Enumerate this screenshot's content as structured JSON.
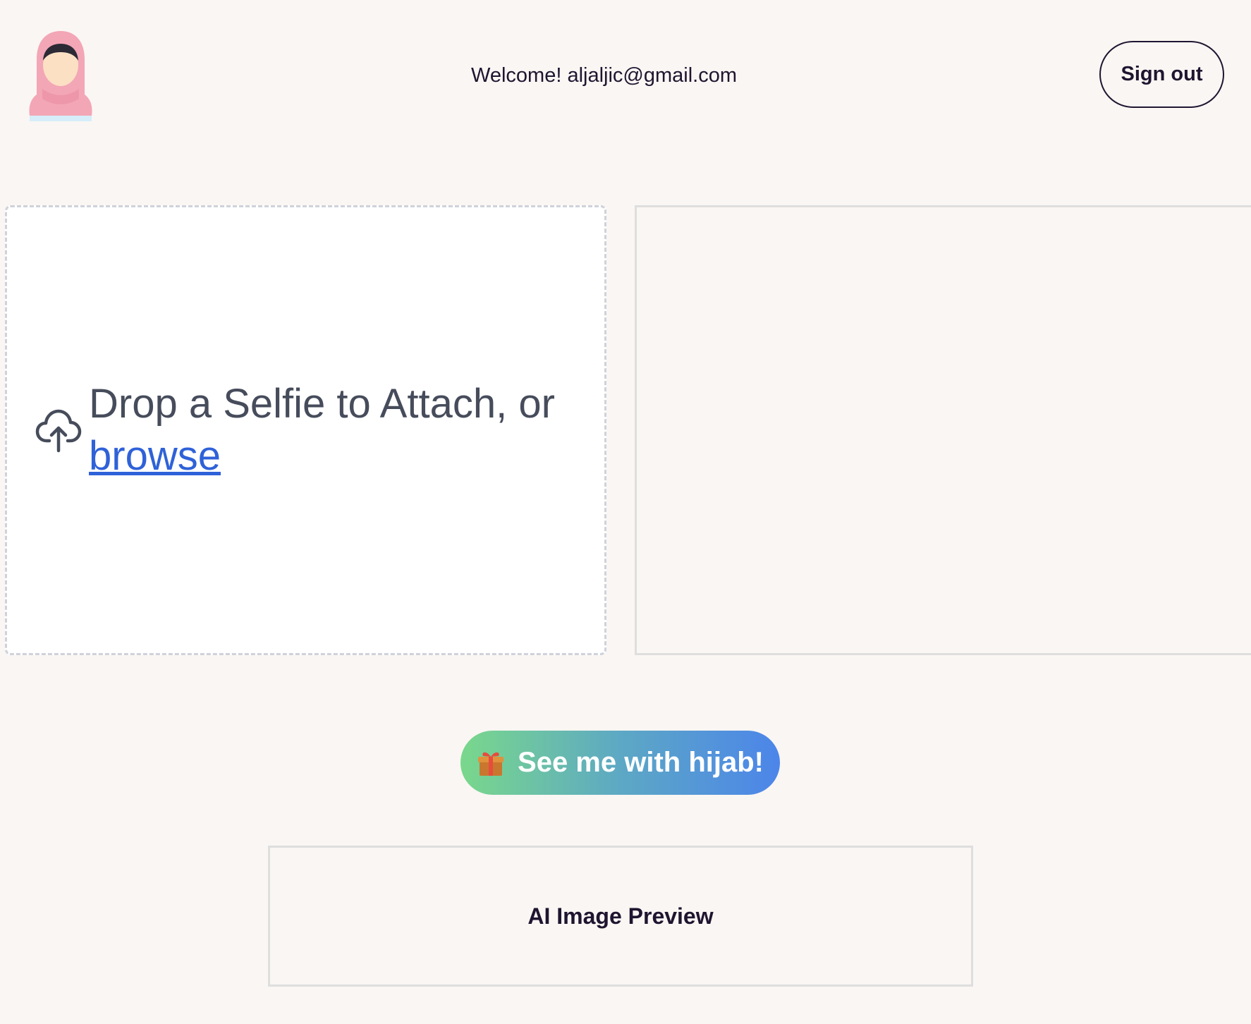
{
  "header": {
    "logo_icon": "hijab-avatar-icon",
    "welcome_text": "Welcome! aljaljic@gmail.com",
    "signout_label": "Sign out"
  },
  "upload": {
    "icon": "cloud-upload-icon",
    "prompt_text": "Drop a Selfie to Attach, or",
    "browse_label": "browse"
  },
  "generate": {
    "icon": "gift-icon",
    "label": "See me with hijab!"
  },
  "result": {
    "placeholder": "AI Image Preview"
  },
  "colors": {
    "background": "#faf6f3",
    "text": "#1f1530",
    "link": "#2f62d8",
    "button_gradient_start": "#79d88b",
    "button_gradient_end": "#4c85ea"
  }
}
